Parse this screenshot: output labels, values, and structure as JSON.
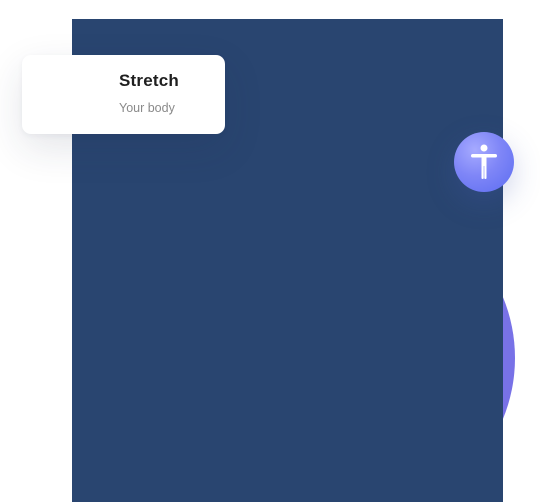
{
  "card": {
    "title": "Stretch",
    "subtitle": "Your body"
  },
  "icons": {
    "accessibility": "accessibility-person-icon"
  },
  "colors": {
    "panel": "#294570",
    "decor_circle": "#7b74e8",
    "button_gradient_start": "#a6aaff",
    "button_gradient_end": "#5b6cf1",
    "card_background": "#ffffff",
    "title_text": "#1f1f1f",
    "subtitle_text": "#8a8a8a"
  }
}
